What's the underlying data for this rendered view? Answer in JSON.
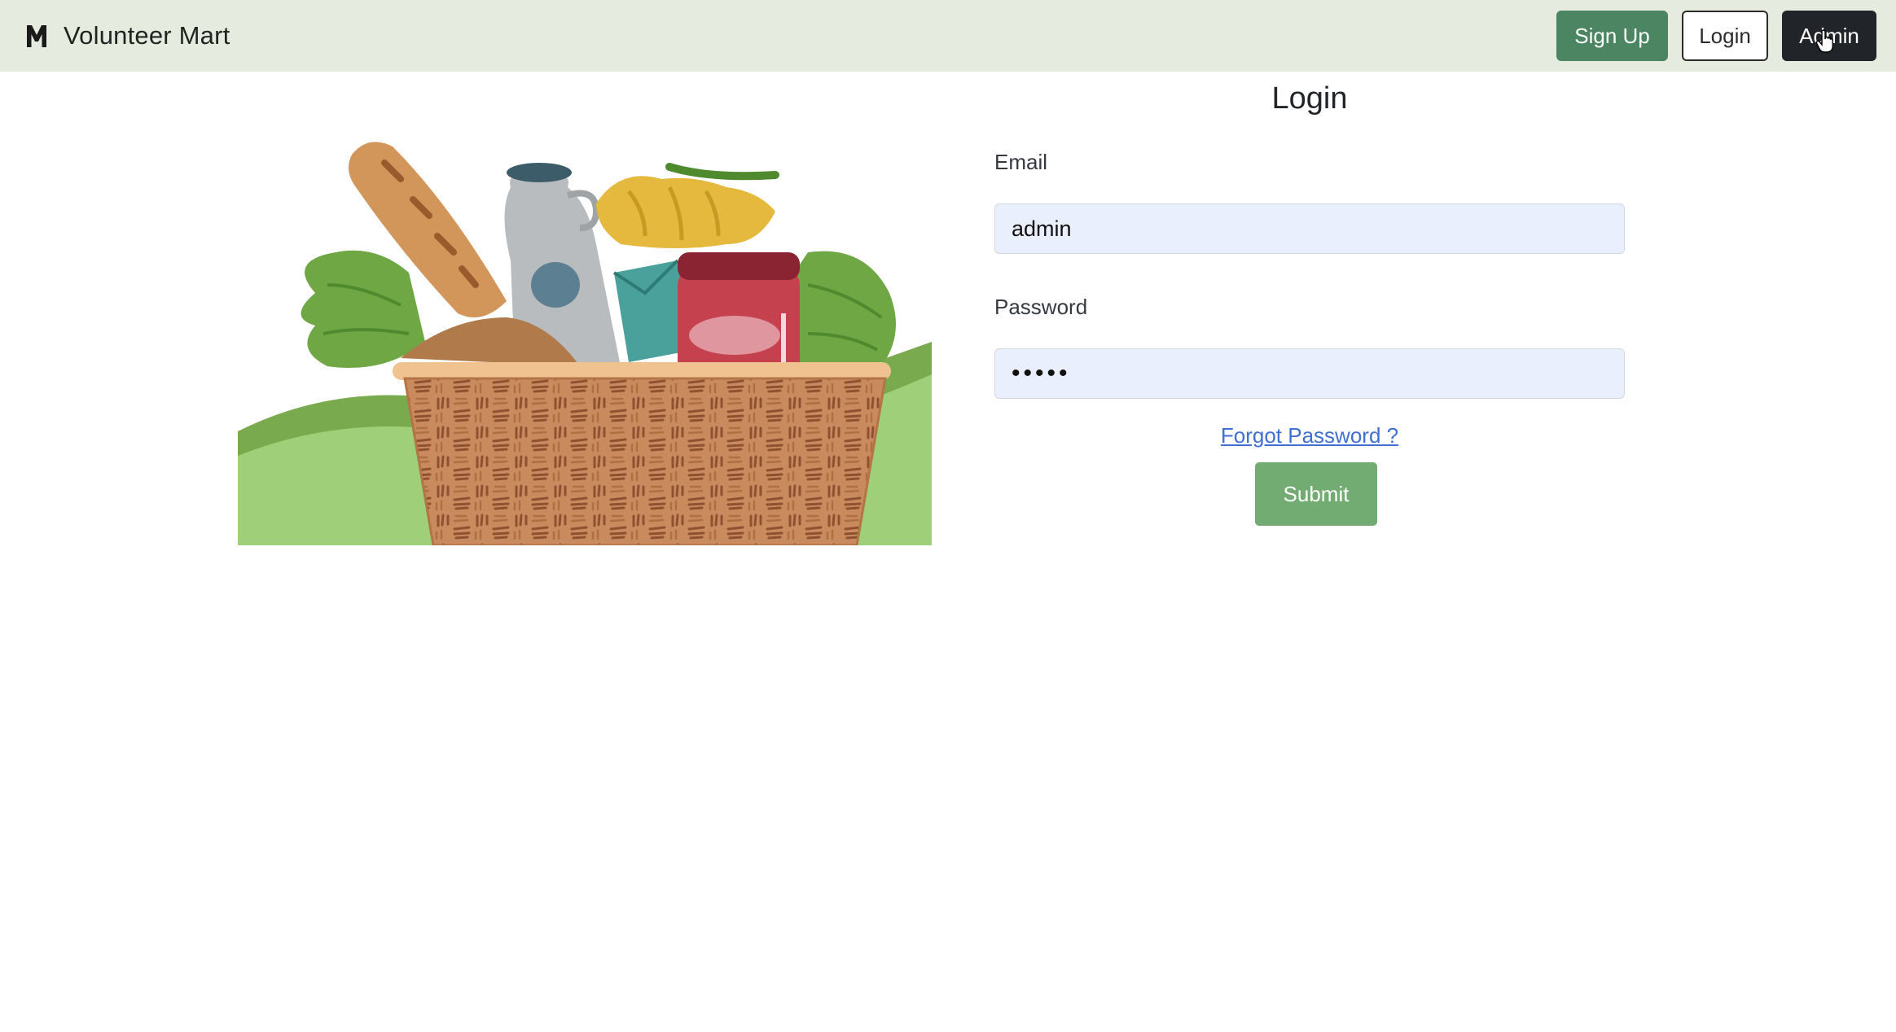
{
  "navbar": {
    "brand_name": "Volunteer Mart",
    "logo_icon": "m-logo-icon",
    "signup_label": "Sign Up",
    "login_label": "Login",
    "admin_label": "Admin"
  },
  "hero": {
    "image": "grocery-basket-illustration"
  },
  "form": {
    "title": "Login",
    "email_label": "Email",
    "email_value": "admin",
    "password_label": "Password",
    "password_value": "•••••",
    "forgot_label": "Forgot Password ?",
    "submit_label": "Submit"
  },
  "colors": {
    "navbar_bg": "#e6ebdf",
    "signup_bg": "#4b8562",
    "admin_bg": "#212529",
    "input_bg": "#e9effc",
    "link": "#3f6fd1",
    "submit_bg": "#73ac72"
  }
}
